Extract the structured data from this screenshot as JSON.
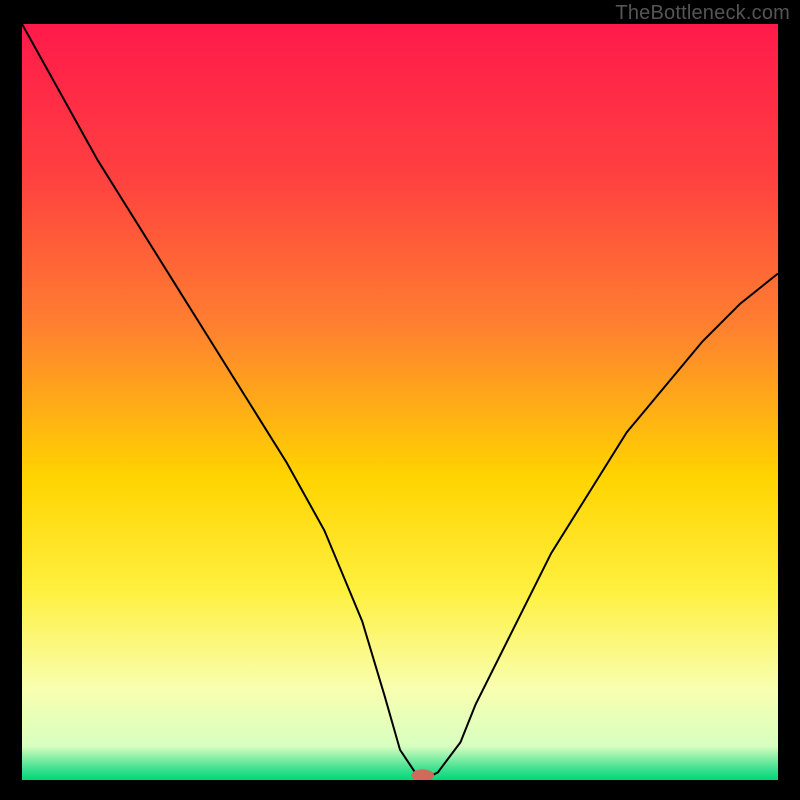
{
  "watermark": "TheBottleneck.com",
  "chart_data": {
    "type": "line",
    "title": "",
    "xlabel": "",
    "ylabel": "",
    "xlim": [
      0,
      100
    ],
    "ylim": [
      0,
      100
    ],
    "background_gradient": {
      "stops": [
        {
          "offset": 0.0,
          "color": "#ff1a4b"
        },
        {
          "offset": 0.2,
          "color": "#ff4040"
        },
        {
          "offset": 0.4,
          "color": "#ff8030"
        },
        {
          "offset": 0.6,
          "color": "#ffd400"
        },
        {
          "offset": 0.75,
          "color": "#fff040"
        },
        {
          "offset": 0.88,
          "color": "#f8ffb0"
        },
        {
          "offset": 0.955,
          "color": "#d8ffc0"
        },
        {
          "offset": 0.985,
          "color": "#40e090"
        },
        {
          "offset": 1.0,
          "color": "#00d878"
        }
      ]
    },
    "series": [
      {
        "name": "bottleneck-curve",
        "x": [
          0,
          5,
          10,
          15,
          20,
          25,
          30,
          35,
          40,
          45,
          48,
          50,
          52,
          53,
          55,
          58,
          60,
          65,
          70,
          75,
          80,
          85,
          90,
          95,
          100
        ],
        "y": [
          100,
          91,
          82,
          74,
          66,
          58,
          50,
          42,
          33,
          21,
          11,
          4,
          1,
          0,
          1,
          5,
          10,
          20,
          30,
          38,
          46,
          52,
          58,
          63,
          67
        ]
      }
    ],
    "marker": {
      "x": 53,
      "y": 0,
      "color": "#d06a5a",
      "rx": 1.5,
      "ry": 0.8
    }
  }
}
